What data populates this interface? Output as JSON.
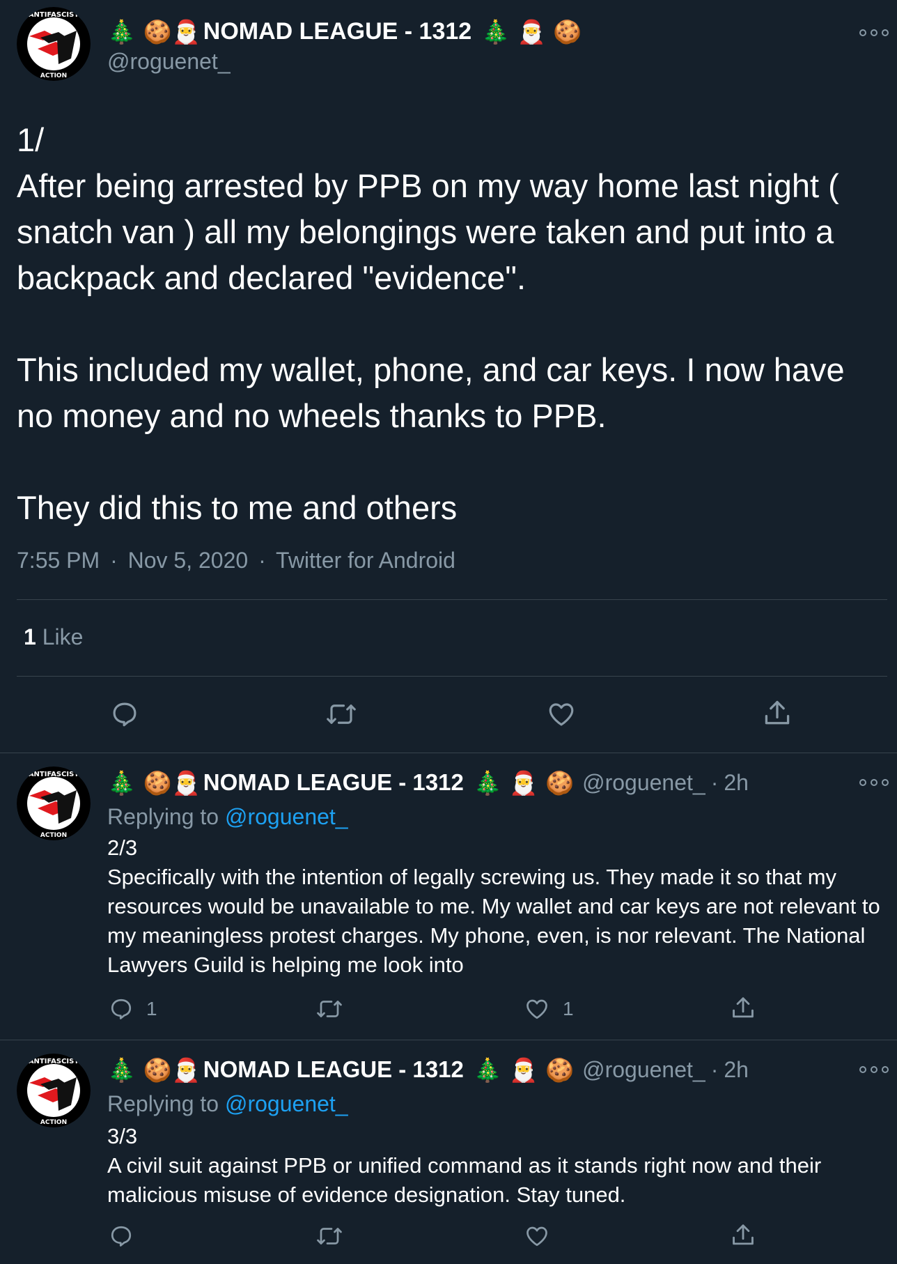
{
  "account": {
    "display_name_prefix": "🎄 🍪🎅",
    "display_name": "NOMAD LEAGUE - 1312",
    "display_name_suffix": "🎄 🎅 🍪",
    "handle": "@roguenet_",
    "avatar_text_top": "ANTIFASCIST",
    "avatar_text_bottom": "ACTION"
  },
  "main_tweet": {
    "paragraphs": [
      "1/",
      "After being arrested by PPB on my way home last night ( snatch van ) all my belongings were taken and put into a backpack and declared \"evidence\".",
      "",
      "This included my wallet, phone, and car keys. I now have no money and no wheels thanks to PPB.",
      "",
      "They did this to me and others"
    ],
    "time": "7:55 PM",
    "date": "Nov 5, 2020",
    "source": "Twitter for Android",
    "sep": "·",
    "like_count": "1",
    "like_label": "Like"
  },
  "replies": [
    {
      "handle": "@roguenet_",
      "sep": "·",
      "age": "2h",
      "replying_label": "Replying to",
      "replying_to": "@roguenet_",
      "lines": [
        "2/3",
        "Specifically with the intention of legally screwing us. They made it so that my resources would be unavailable to me. My wallet and car keys are not relevant to my meaningless protest charges. My phone, even, is nor relevant. The National Lawyers Guild is helping me look into"
      ],
      "reply_count": "1",
      "retweet_count": "",
      "like_count": "1"
    },
    {
      "handle": "@roguenet_",
      "sep": "·",
      "age": "2h",
      "replying_label": "Replying to",
      "replying_to": "@roguenet_",
      "lines": [
        "3/3",
        "A civil suit against PPB or unified command as it stands right now and their malicious misuse of evidence designation. Stay tuned."
      ],
      "reply_count": "",
      "retweet_count": "",
      "like_count": ""
    }
  ],
  "icons": {
    "reply": "reply-icon",
    "retweet": "retweet-icon",
    "like": "heart-icon",
    "share": "share-icon",
    "more": "more-options-icon"
  },
  "colors": {
    "background": "#15202b",
    "text": "#ffffff",
    "secondary": "#8899a6",
    "link": "#1da1f2",
    "divider": "#38444d",
    "flag_red": "#e0191e"
  }
}
